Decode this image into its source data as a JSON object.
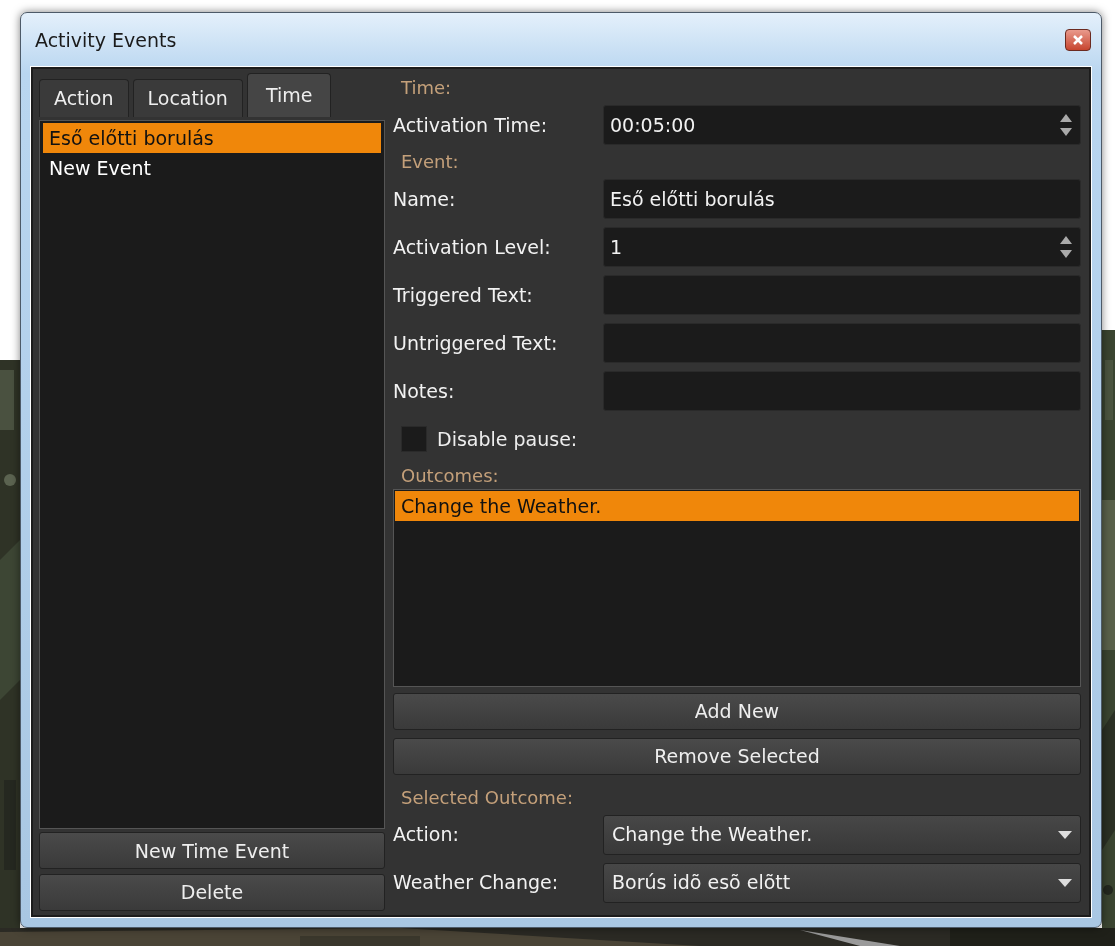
{
  "window": {
    "title": "Activity Events"
  },
  "tabs": [
    {
      "label": "Action",
      "selected": false
    },
    {
      "label": "Location",
      "selected": false
    },
    {
      "label": "Time",
      "selected": true
    }
  ],
  "events": [
    {
      "label": "Eső előtti borulás",
      "selected": true
    },
    {
      "label": "New Event",
      "selected": false
    }
  ],
  "event_buttons": [
    "New Time Event",
    "Delete"
  ],
  "form": [
    {
      "kind": "section",
      "label": "Time:"
    },
    {
      "kind": "spin",
      "label": "Activation Time:",
      "value": "00:05:00"
    },
    {
      "kind": "section",
      "label": "Event:"
    },
    {
      "kind": "text",
      "label": "Name:",
      "value": "Eső előtti borulás"
    },
    {
      "kind": "spin",
      "label": "Activation Level:",
      "value": "1"
    },
    {
      "kind": "text",
      "label": "Triggered Text:"
    },
    {
      "kind": "text",
      "label": "Untriggered Text:"
    },
    {
      "kind": "text",
      "label": "Notes:"
    },
    {
      "kind": "checkbox",
      "label": "Disable pause:",
      "checked": false
    },
    {
      "kind": "section",
      "label": "Outcomes:"
    }
  ],
  "outcomes": [
    {
      "label": "Change the Weather.",
      "selected": true
    }
  ],
  "outcome_buttons": [
    "Add New",
    "Remove Selected"
  ],
  "selected_outcome": {
    "title": "Selected Outcome:",
    "fields": [
      {
        "label": "Action:",
        "value": "Change the Weather."
      },
      {
        "label": "Weather Change:",
        "value": "Borús idõ esõ elõtt"
      }
    ]
  }
}
